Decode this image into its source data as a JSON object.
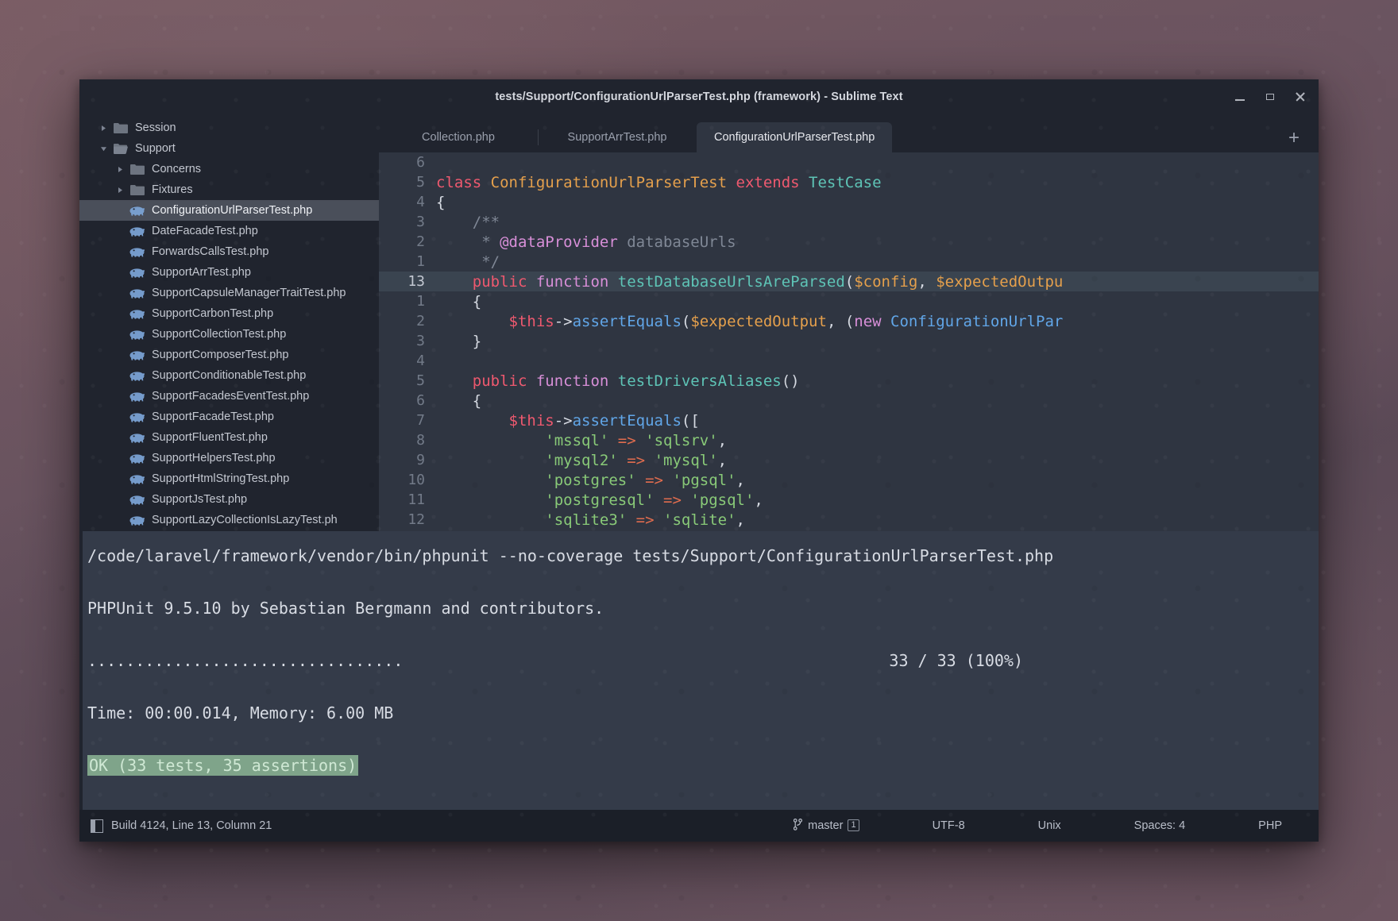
{
  "window": {
    "title": "tests/Support/ConfigurationUrlParserTest.php (framework) - Sublime Text",
    "controls": {
      "minimize": "minimize-icon",
      "maximize": "maximize-icon",
      "close": "close-icon"
    }
  },
  "sidebar": {
    "items": [
      {
        "type": "folder",
        "label": "Session",
        "indent": 1,
        "expanded": false,
        "selected": false
      },
      {
        "type": "folder",
        "label": "Support",
        "indent": 1,
        "expanded": true,
        "selected": false
      },
      {
        "type": "folder",
        "label": "Concerns",
        "indent": 2,
        "expanded": false,
        "selected": false
      },
      {
        "type": "folder",
        "label": "Fixtures",
        "indent": 2,
        "expanded": false,
        "selected": false
      },
      {
        "type": "file",
        "label": "ConfigurationUrlParserTest.php",
        "indent": 2,
        "selected": true
      },
      {
        "type": "file",
        "label": "DateFacadeTest.php",
        "indent": 2,
        "selected": false
      },
      {
        "type": "file",
        "label": "ForwardsCallsTest.php",
        "indent": 2,
        "selected": false
      },
      {
        "type": "file",
        "label": "SupportArrTest.php",
        "indent": 2,
        "selected": false
      },
      {
        "type": "file",
        "label": "SupportCapsuleManagerTraitTest.php",
        "indent": 2,
        "selected": false
      },
      {
        "type": "file",
        "label": "SupportCarbonTest.php",
        "indent": 2,
        "selected": false
      },
      {
        "type": "file",
        "label": "SupportCollectionTest.php",
        "indent": 2,
        "selected": false
      },
      {
        "type": "file",
        "label": "SupportComposerTest.php",
        "indent": 2,
        "selected": false
      },
      {
        "type": "file",
        "label": "SupportConditionableTest.php",
        "indent": 2,
        "selected": false
      },
      {
        "type": "file",
        "label": "SupportFacadesEventTest.php",
        "indent": 2,
        "selected": false
      },
      {
        "type": "file",
        "label": "SupportFacadeTest.php",
        "indent": 2,
        "selected": false
      },
      {
        "type": "file",
        "label": "SupportFluentTest.php",
        "indent": 2,
        "selected": false
      },
      {
        "type": "file",
        "label": "SupportHelpersTest.php",
        "indent": 2,
        "selected": false
      },
      {
        "type": "file",
        "label": "SupportHtmlStringTest.php",
        "indent": 2,
        "selected": false
      },
      {
        "type": "file",
        "label": "SupportJsTest.php",
        "indent": 2,
        "selected": false
      },
      {
        "type": "file",
        "label": "SupportLazyCollectionIsLazyTest.ph",
        "indent": 2,
        "selected": false
      }
    ]
  },
  "tabs": {
    "items": [
      {
        "label": "Collection.php",
        "active": false
      },
      {
        "label": "SupportArrTest.php",
        "active": false
      },
      {
        "label": "ConfigurationUrlParserTest.php",
        "active": true
      }
    ],
    "add_label": "+"
  },
  "editor": {
    "lines": [
      {
        "num": "6",
        "highlight": false,
        "tokens": []
      },
      {
        "num": "5",
        "highlight": false,
        "tokens": [
          {
            "t": "class ",
            "c": "k-class"
          },
          {
            "t": "ConfigurationUrlParserTest ",
            "c": "k-cls"
          },
          {
            "t": "extends ",
            "c": "k-class"
          },
          {
            "t": "TestCase",
            "c": "k-name"
          }
        ]
      },
      {
        "num": "4",
        "highlight": false,
        "tokens": [
          {
            "t": "{",
            "c": "k-pnc"
          }
        ]
      },
      {
        "num": "3",
        "highlight": false,
        "tokens": [
          {
            "t": "    /**",
            "c": "k-cmt"
          }
        ]
      },
      {
        "num": "2",
        "highlight": false,
        "tokens": [
          {
            "t": "     * ",
            "c": "k-cmt"
          },
          {
            "t": "@dataProvider",
            "c": "k-cmt2"
          },
          {
            "t": " databaseUrls",
            "c": "k-cmt"
          }
        ]
      },
      {
        "num": "1",
        "highlight": false,
        "tokens": [
          {
            "t": "     */",
            "c": "k-cmt"
          }
        ]
      },
      {
        "num": "13",
        "highlight": true,
        "tokens": [
          {
            "t": "    ",
            "c": "k-plain"
          },
          {
            "t": "public ",
            "c": "k-key"
          },
          {
            "t": "function ",
            "c": "k-fn"
          },
          {
            "t": "testDatabaseUrlsAreParsed",
            "c": "k-name"
          },
          {
            "t": "(",
            "c": "k-pnc"
          },
          {
            "t": "$config",
            "c": "k-var"
          },
          {
            "t": ", ",
            "c": "k-pnc"
          },
          {
            "t": "$expectedOutpu",
            "c": "k-var"
          }
        ]
      },
      {
        "num": "1",
        "highlight": false,
        "tokens": [
          {
            "t": "    {",
            "c": "k-pnc"
          }
        ]
      },
      {
        "num": "2",
        "highlight": false,
        "tokens": [
          {
            "t": "        ",
            "c": "k-plain"
          },
          {
            "t": "$this",
            "c": "k-this"
          },
          {
            "t": "->",
            "c": "k-pnc"
          },
          {
            "t": "assertEquals",
            "c": "k-call"
          },
          {
            "t": "(",
            "c": "k-pnc"
          },
          {
            "t": "$expectedOutput",
            "c": "k-var"
          },
          {
            "t": ", (",
            "c": "k-pnc"
          },
          {
            "t": "new ",
            "c": "k-fn"
          },
          {
            "t": "ConfigurationUrlPar",
            "c": "k-call"
          }
        ]
      },
      {
        "num": "3",
        "highlight": false,
        "tokens": [
          {
            "t": "    }",
            "c": "k-pnc"
          }
        ]
      },
      {
        "num": "4",
        "highlight": false,
        "tokens": []
      },
      {
        "num": "5",
        "highlight": false,
        "tokens": [
          {
            "t": "    ",
            "c": "k-plain"
          },
          {
            "t": "public ",
            "c": "k-key"
          },
          {
            "t": "function ",
            "c": "k-fn"
          },
          {
            "t": "testDriversAliases",
            "c": "k-name"
          },
          {
            "t": "()",
            "c": "k-pnc"
          }
        ]
      },
      {
        "num": "6",
        "highlight": false,
        "tokens": [
          {
            "t": "    {",
            "c": "k-pnc"
          }
        ]
      },
      {
        "num": "7",
        "highlight": false,
        "tokens": [
          {
            "t": "        ",
            "c": "k-plain"
          },
          {
            "t": "$this",
            "c": "k-this"
          },
          {
            "t": "->",
            "c": "k-pnc"
          },
          {
            "t": "assertEquals",
            "c": "k-call"
          },
          {
            "t": "([",
            "c": "k-pnc"
          }
        ]
      },
      {
        "num": "8",
        "highlight": false,
        "tokens": [
          {
            "t": "            ",
            "c": "k-plain"
          },
          {
            "t": "'mssql'",
            "c": "k-str"
          },
          {
            "t": " => ",
            "c": "k-op"
          },
          {
            "t": "'sqlsrv'",
            "c": "k-str"
          },
          {
            "t": ",",
            "c": "k-pnc"
          }
        ]
      },
      {
        "num": "9",
        "highlight": false,
        "tokens": [
          {
            "t": "            ",
            "c": "k-plain"
          },
          {
            "t": "'mysql2'",
            "c": "k-str"
          },
          {
            "t": " => ",
            "c": "k-op"
          },
          {
            "t": "'mysql'",
            "c": "k-str"
          },
          {
            "t": ",",
            "c": "k-pnc"
          }
        ]
      },
      {
        "num": "10",
        "highlight": false,
        "tokens": [
          {
            "t": "            ",
            "c": "k-plain"
          },
          {
            "t": "'postgres'",
            "c": "k-str"
          },
          {
            "t": " => ",
            "c": "k-op"
          },
          {
            "t": "'pgsql'",
            "c": "k-str"
          },
          {
            "t": ",",
            "c": "k-pnc"
          }
        ]
      },
      {
        "num": "11",
        "highlight": false,
        "tokens": [
          {
            "t": "            ",
            "c": "k-plain"
          },
          {
            "t": "'postgresql'",
            "c": "k-str"
          },
          {
            "t": " => ",
            "c": "k-op"
          },
          {
            "t": "'pgsql'",
            "c": "k-str"
          },
          {
            "t": ",",
            "c": "k-pnc"
          }
        ]
      },
      {
        "num": "12",
        "highlight": false,
        "tokens": [
          {
            "t": "            ",
            "c": "k-plain"
          },
          {
            "t": "'sqlite3'",
            "c": "k-str"
          },
          {
            "t": " => ",
            "c": "k-op"
          },
          {
            "t": "'sqlite'",
            "c": "k-str"
          },
          {
            "t": ",",
            "c": "k-pnc"
          }
        ]
      }
    ]
  },
  "terminal": {
    "lines": [
      {
        "text": "/code/laravel/framework/vendor/bin/phpunit --no-coverage tests/Support/ConfigurationUrlParserTest.php",
        "style": "plain"
      },
      {
        "text": "",
        "style": "plain"
      },
      {
        "text": "PHPUnit 9.5.10 by Sebastian Bergmann and contributors.",
        "style": "plain"
      },
      {
        "text": "",
        "style": "plain"
      },
      {
        "text": ".................................",
        "right": "33 / 33 (100%)",
        "style": "progress"
      },
      {
        "text": "",
        "style": "plain"
      },
      {
        "text": "Time: 00:00.014, Memory: 6.00 MB",
        "style": "plain"
      },
      {
        "text": "",
        "style": "plain"
      },
      {
        "text": "OK (33 tests, 35 assertions)",
        "style": "ok"
      }
    ]
  },
  "statusbar": {
    "left": "Build 4124, Line 13, Column 21",
    "branch": "master",
    "branch_count": "1",
    "encoding": "UTF-8",
    "line_endings": "Unix",
    "indentation": "Spaces: 4",
    "syntax": "PHP"
  },
  "colors": {
    "window_bg": "#20242e",
    "editor_bg": "#2f3541",
    "terminal_bg": "#343b49",
    "statusbar_bg": "#1b1f28",
    "selection": "#4a4f5a",
    "ok_highlight": "#7fa48a",
    "php_icon": "#7aa2d4"
  }
}
